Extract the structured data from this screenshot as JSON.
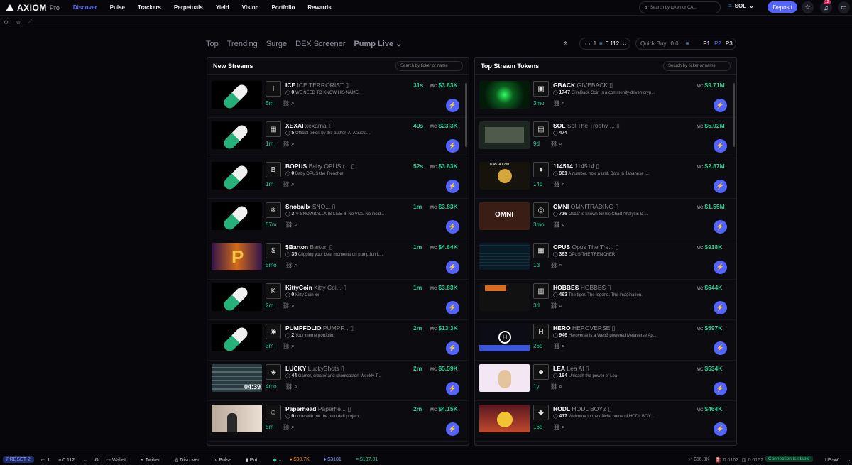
{
  "app": {
    "name": "AXIOM",
    "tier": "Pro"
  },
  "nav": [
    "Discover",
    "Pulse",
    "Trackers",
    "Perpetuals",
    "Yield",
    "Vision",
    "Portfolio",
    "Rewards"
  ],
  "nav_active": "Discover",
  "search": {
    "placeholder": "Search by token or CA..."
  },
  "chain": "SOL",
  "deposit": "Deposit",
  "notif_badge": "12",
  "tabs": [
    "Top",
    "Trending",
    "Surge",
    "DEX Screener",
    "Pump Live"
  ],
  "tab_active": "Pump Live",
  "controls": {
    "wallet_count": "1",
    "wallet_value": "0.112",
    "quick_buy_label": "Quick Buy",
    "quick_buy_value": "0.0",
    "presets": [
      "P1",
      "P2",
      "P3"
    ]
  },
  "left": {
    "title": "New Streams",
    "search": "Search by ticker or name",
    "rows": [
      {
        "av": "I",
        "sym": "ICE",
        "name": "ICE TERRORIST",
        "n": "0",
        "desc": "WE NEED TO KNOW HIS NAME.",
        "age": "5m",
        "time": "31s",
        "mc": "$3.83K",
        "thumb": "pill"
      },
      {
        "av": "▦",
        "sym": "XEXAI",
        "name": "xexamai",
        "n": "5",
        "desc": "Official token by the author. AI Assista...",
        "age": "1m",
        "time": "40s",
        "mc": "$23.3K",
        "thumb": "pill"
      },
      {
        "av": "B",
        "sym": "BOPUS",
        "name": "Baby OPUS t...",
        "n": "0",
        "desc": "Baby OPUS the Trencher",
        "age": "1m",
        "time": "52s",
        "mc": "$3.83K",
        "thumb": "pill"
      },
      {
        "av": "❄",
        "sym": "Snoballx",
        "name": "SNO...",
        "n": "3",
        "desc": "❄ SNOWBALLX IS LIVE ❄ No VCs. No insid...",
        "age": "57m",
        "time": "1m",
        "mc": "$3.83K",
        "thumb": "pill"
      },
      {
        "av": "$",
        "sym": "$Barton",
        "name": "Barton",
        "n": "35",
        "desc": "Clipping your best moments on pump.fun L...",
        "age": "5mo",
        "time": "1m",
        "mc": "$4.84K",
        "thumb": "p"
      },
      {
        "av": "K",
        "sym": "KittyCoin",
        "name": "Kitty Coi...",
        "n": "0",
        "desc": "Kitty Coin xx",
        "age": "2m",
        "time": "1m",
        "mc": "$3.83K",
        "thumb": "pill"
      },
      {
        "av": "◉",
        "sym": "PUMPFOLIO",
        "name": "PUMPF...",
        "n": "2",
        "desc": "Your meme portfolio!",
        "age": "3m",
        "time": "2m",
        "mc": "$13.3K",
        "thumb": "pill"
      },
      {
        "av": "◈",
        "sym": "LUCKY",
        "name": "LuckyShots",
        "n": "44",
        "desc": "Gamer, creator and shoutcaster! Weekly T...",
        "age": "4mo",
        "time": "2m",
        "mc": "$5.59K",
        "thumb": "game"
      },
      {
        "av": "☺",
        "sym": "Paperhead",
        "name": "Paperhe...",
        "n": "0",
        "desc": "code with me the next defi project",
        "age": "5m",
        "time": "2m",
        "mc": "$4.15K",
        "thumb": "cam"
      }
    ]
  },
  "right": {
    "title": "Top Stream Tokens",
    "search": "Search by ticker or name",
    "rows": [
      {
        "av": "▣",
        "sym": "GBACK",
        "name": "GIVEBACK",
        "n": "1747",
        "desc": "GiveBack Coin is a community-driven cryp...",
        "age": "3mo",
        "mc": "$9.71M",
        "thumb": "green"
      },
      {
        "av": "▤",
        "sym": "SOL",
        "name": "Sol The Trophy ...",
        "n": "474",
        "desc": "",
        "age": "9d",
        "mc": "$5.02M",
        "thumb": "screen"
      },
      {
        "av": "●",
        "sym": "114514",
        "name": "114514",
        "n": "961",
        "desc": "A number, now a unit. Born in Japanese i...",
        "age": "14d",
        "mc": "$2.87M",
        "thumb": "coin",
        "thumb_label": "114514 Coin"
      },
      {
        "av": "◎",
        "sym": "OMNI",
        "name": "OMNITRADING",
        "n": "716",
        "desc": "Oscar is known for his Chart Analysis & ...",
        "age": "3mo",
        "mc": "$1.55M",
        "thumb": "omni",
        "thumb_label": "OMNI"
      },
      {
        "av": "▦",
        "sym": "OPUS",
        "name": "Opus The Tre...",
        "n": "363",
        "desc": "OPUS THE TRENCHER",
        "age": "1d",
        "mc": "$918K",
        "thumb": "code"
      },
      {
        "av": "▥",
        "sym": "HOBBES",
        "name": "HOBBES",
        "n": "463",
        "desc": "The tiger. The legend. The imagination.",
        "age": "3d",
        "mc": "$644K",
        "thumb": "hob"
      },
      {
        "av": "H",
        "sym": "HERO",
        "name": "HEROVERSE",
        "n": "946",
        "desc": "Heroverse is a Web3 powered Metaverse Ap...",
        "age": "26d",
        "mc": "$597K",
        "thumb": "hero"
      },
      {
        "av": "☻",
        "sym": "LEA",
        "name": "Lea AI",
        "n": "184",
        "desc": "Unleash the power of Lea",
        "age": "1y",
        "mc": "$534K",
        "thumb": "lea"
      },
      {
        "av": "◆",
        "sym": "HODL",
        "name": "HODL BOYZ",
        "n": "417",
        "desc": "Welcome to the official home of HODL BOY...",
        "age": "16d",
        "mc": "$464K",
        "thumb": "hodl"
      }
    ]
  },
  "footer": {
    "preset": "PRESET 2",
    "wallet_count": "1",
    "wallet_value": "0.112",
    "items": [
      "Wallet",
      "Twitter",
      "Discover",
      "Pulse",
      "PnL"
    ],
    "btc": "$90.7K",
    "eth": "$3101",
    "sol": "$137.01",
    "mcap": "$56.3K",
    "gas1": "0.0162",
    "gas2": "0.0162",
    "connection": "Connection is stable",
    "region": "US-W"
  }
}
